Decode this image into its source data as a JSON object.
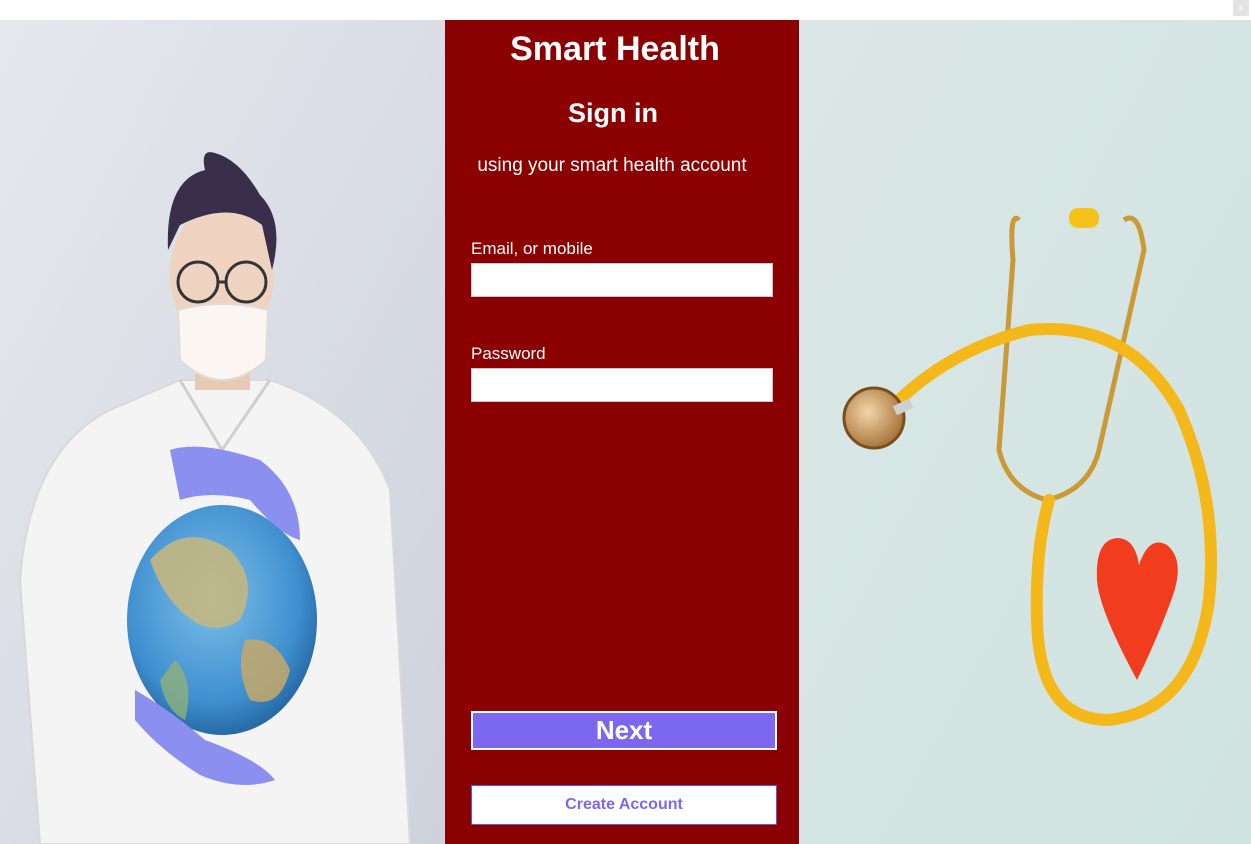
{
  "window": {
    "close_glyph": "x"
  },
  "app": {
    "title": "Smart Health"
  },
  "signin": {
    "heading": "Sign in",
    "subtitle": "using your smart health account",
    "email_label": "Email, or mobile",
    "email_value": "",
    "password_label": "Password",
    "password_value": "",
    "next_label": "Next",
    "create_account_label": "Create Account"
  },
  "colors": {
    "panel_background": "#8b0000",
    "next_button": "#7b68ee",
    "create_account_text": "#7b68ee",
    "create_account_border": "#6a5acd"
  },
  "images": {
    "left": "doctor-with-globe-photo",
    "right": "stethoscope-with-heart-photo"
  }
}
